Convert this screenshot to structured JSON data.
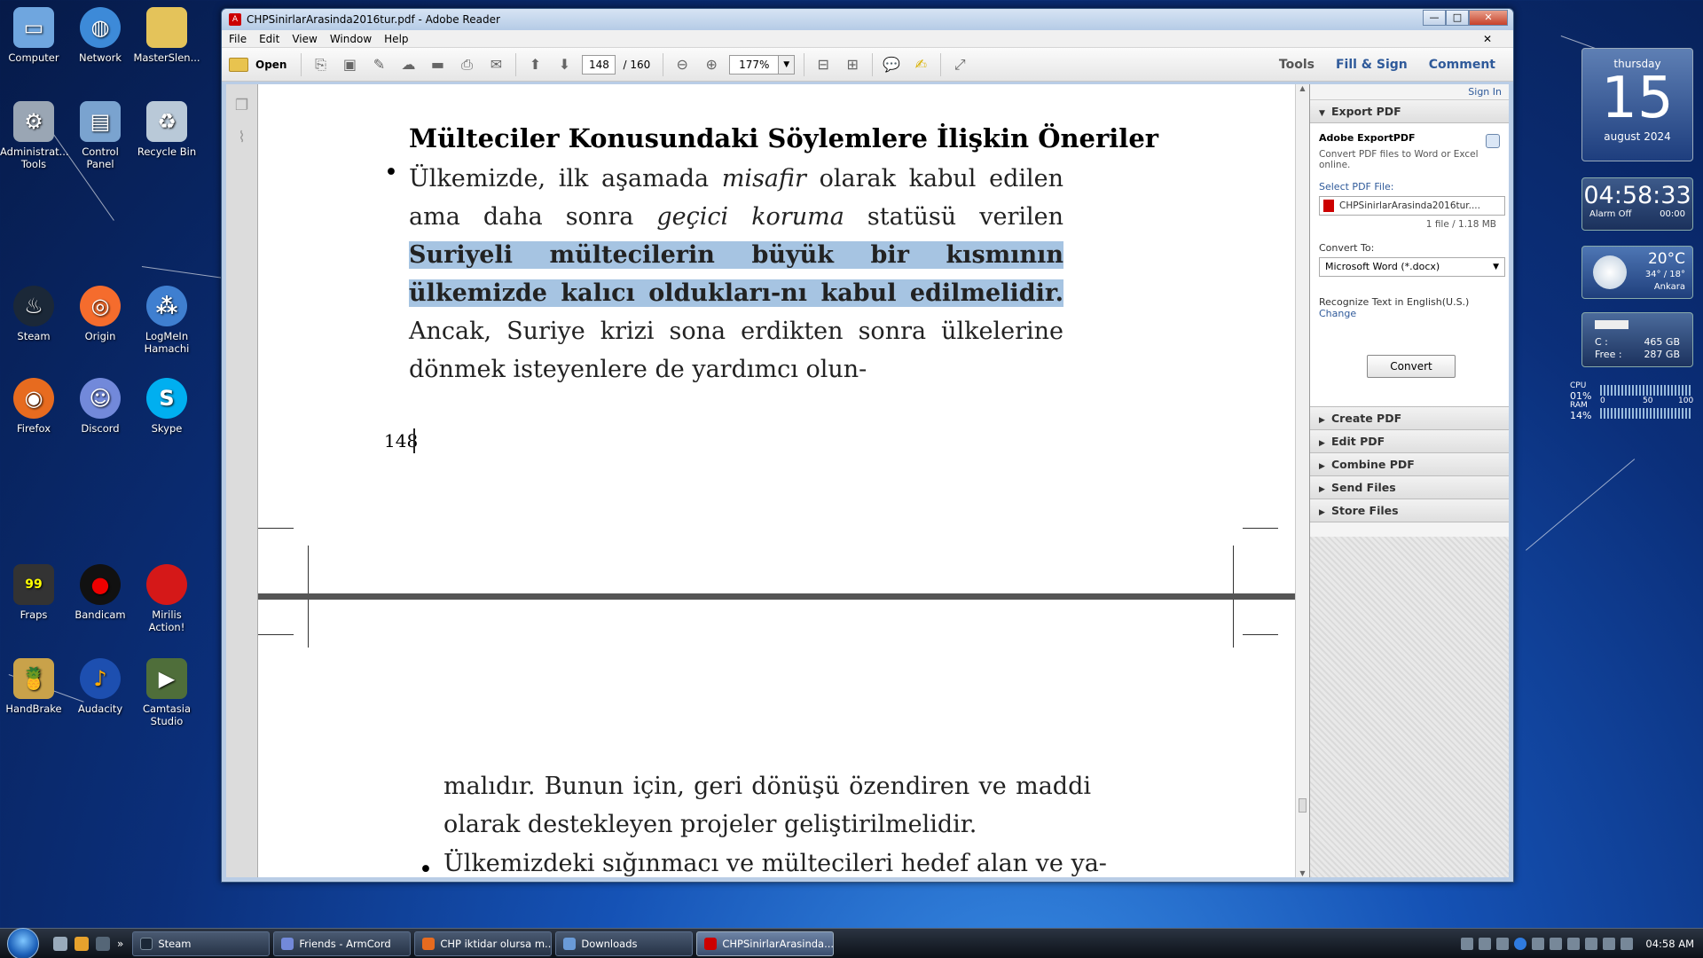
{
  "desktop": {
    "icons": [
      {
        "label": "Computer"
      },
      {
        "label": "Network"
      },
      {
        "label": "MasterSlen..."
      },
      {
        "label": "Administrat... Tools"
      },
      {
        "label": "Control Panel"
      },
      {
        "label": "Recycle Bin"
      },
      {
        "label": "Steam"
      },
      {
        "label": "Origin"
      },
      {
        "label": "LogMeIn Hamachi"
      },
      {
        "label": "Firefox"
      },
      {
        "label": "Discord"
      },
      {
        "label": "Skype"
      },
      {
        "label": "Fraps"
      },
      {
        "label": "Bandicam"
      },
      {
        "label": "Mirilis Action!"
      },
      {
        "label": "HandBrake"
      },
      {
        "label": "Audacity"
      },
      {
        "label": "Camtasia Studio"
      }
    ],
    "fraps_badge": "99"
  },
  "window": {
    "title": "CHPSinirlarArasinda2016tur.pdf - Adobe Reader",
    "buttons": {
      "minimize": "—",
      "maximize": "□",
      "close": "✕"
    }
  },
  "menu": {
    "file": "File",
    "edit": "Edit",
    "view": "View",
    "window": "Window",
    "help": "Help",
    "close": "✕"
  },
  "toolbar": {
    "open": "Open",
    "page_current": "148",
    "page_total": "/ 160",
    "zoom": "177%",
    "tools": "Tools",
    "fill_sign": "Fill & Sign",
    "comment": "Comment"
  },
  "document": {
    "heading": "Mülteciler Konusundaki Söylemlere İlişkin Öneriler",
    "bullet": "•",
    "p1_a": "Ülkemizde, ilk aşamada ",
    "p1_misafir": "misafir",
    "p1_b": " olarak kabul edilen ama daha sonra ",
    "p1_gecici": "geçici koruma",
    "p1_c": " statüsü verilen ",
    "p1_highlight": "Suriyeli mültecilerin büyük bir kısmının ülkemizde kalıcı oldukları-nı kabul edilmelidir.",
    "p1_d": " Ancak, Suriye krizi sona erdikten sonra ülkelerine dönmek isteyenlere de yardımcı olun-",
    "page_number": "148",
    "p2": "malıdır. Bunun için, geri dönüşü özendiren ve maddi olarak destekleyen projeler geliştirilmelidir.",
    "p3": "Ülkemizdeki sığınmacı ve mültecileri hedef alan ve ya-"
  },
  "right_panel": {
    "sign_in": "Sign In",
    "export_pdf": "Export PDF",
    "adobe_exportpdf": "Adobe ExportPDF",
    "description": "Convert PDF files to Word or Excel online.",
    "select_label": "Select PDF File:",
    "file_name": "CHPSinirlarArasinda2016tur....",
    "file_info": "1 file / 1.18 MB",
    "convert_to_label": "Convert To:",
    "convert_to_value": "Microsoft Word (*.docx)",
    "recognize": "Recognize Text in English(U.S.)",
    "change": "Change",
    "convert_button": "Convert",
    "sections": [
      "Create PDF",
      "Edit PDF",
      "Combine PDF",
      "Send Files",
      "Store Files"
    ]
  },
  "gadgets": {
    "calendar": {
      "weekday": "thursday",
      "day": "15",
      "month_year": "august 2024"
    },
    "clock": {
      "time": "04:58:33",
      "alarm": "Alarm Off",
      "alarm_time": "00:00"
    },
    "weather": {
      "temp": "20°C",
      "range": "34° / 18°",
      "city": "Ankara"
    },
    "drive": {
      "label_c": "C :",
      "size": "465 GB",
      "label_free": "Free :",
      "free": "287 GB"
    },
    "meter": {
      "cpu_label": "CPU",
      "cpu": "01%",
      "ram_label": "RAM",
      "ram": "14%",
      "scale0": "0",
      "scale50": "50",
      "scale100": "100"
    }
  },
  "taskbar": {
    "items": [
      {
        "label": "Steam"
      },
      {
        "label": "Friends - ArmCord"
      },
      {
        "label": "CHP iktidar olursa m..."
      },
      {
        "label": "Downloads"
      },
      {
        "label": "CHPSinirlarArasinda..."
      }
    ],
    "clock": "04:58 AM"
  },
  "colors": {
    "highlight": "#a6c4e2",
    "link": "#2f5a9a"
  }
}
